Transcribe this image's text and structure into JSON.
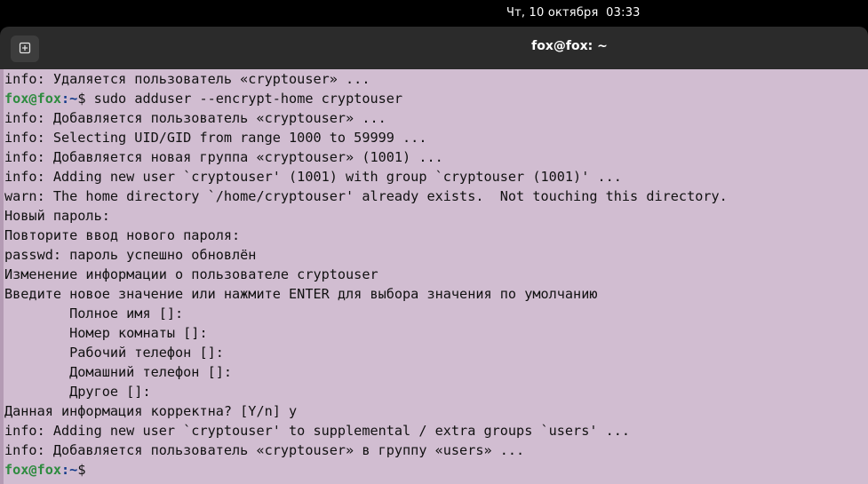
{
  "topbar": {
    "datetime": "Чт, 10 октября  03:33"
  },
  "window": {
    "title": "fox@fox: ~",
    "new_tab_icon": "new-tab-icon"
  },
  "terminal": {
    "lines": [
      {
        "text": "info: Удаляется пользователь «cryptouser» ..."
      },
      {
        "prompt_user": "fox@fox",
        "prompt_path": ":~",
        "prompt_suffix": "$",
        "text": " sudo adduser --encrypt-home cryptouser"
      },
      {
        "text": "info: Добавляется пользователь «cryptouser» ..."
      },
      {
        "text": "info: Selecting UID/GID from range 1000 to 59999 ..."
      },
      {
        "text": "info: Добавляется новая группа «cryptouser» (1001) ..."
      },
      {
        "text": "info: Adding new user `cryptouser' (1001) with group `cryptouser (1001)' ..."
      },
      {
        "text": "warn: The home directory `/home/cryptouser' already exists.  Not touching this directory."
      },
      {
        "text": "Новый пароль:"
      },
      {
        "text": "Повторите ввод нового пароля:"
      },
      {
        "text": "passwd: пароль успешно обновлён"
      },
      {
        "text": "Изменение информации о пользователе cryptouser"
      },
      {
        "text": "Введите новое значение или нажмите ENTER для выбора значения по умолчанию"
      },
      {
        "text": "        Полное имя []:"
      },
      {
        "text": "        Номер комнаты []:"
      },
      {
        "text": "        Рабочий телефон []:"
      },
      {
        "text": "        Домашний телефон []:"
      },
      {
        "text": "        Другое []:"
      },
      {
        "text": "Данная информация корректна? [Y/n] y"
      },
      {
        "text": "info: Adding new user `cryptouser' to supplemental / extra groups `users' ..."
      },
      {
        "text": "info: Добавляется пользователь «cryptouser» в группу «users» ..."
      },
      {
        "prompt_user": "fox@fox",
        "prompt_path": ":~",
        "prompt_suffix": "$",
        "text": ""
      }
    ]
  },
  "colors": {
    "terminal_bg": "#d1bdd1",
    "prompt_user": "#2e8b3f",
    "prompt_path": "#123a8a",
    "titlebar_bg": "#2b2b2b"
  }
}
